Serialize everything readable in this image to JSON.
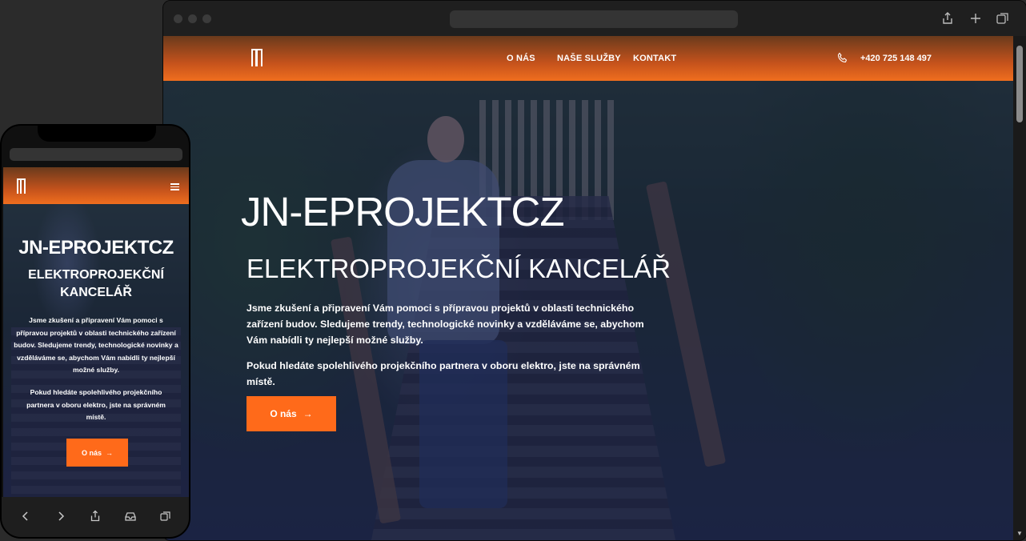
{
  "site": {
    "nav": [
      "O NÁS",
      "NAŠE SLUŽBY",
      "KONTAKT"
    ],
    "phone": "+420 725 148 497"
  },
  "hero": {
    "title": "JN-EPROJEKTCZ",
    "subtitle": "ELEKTROPROJEKČNÍ KANCELÁŘ",
    "paragraph1": "Jsme zkušení a připravení Vám pomoci s přípravou projektů v oblasti technického zařízení budov. Sledujeme trendy, technologické novinky a vzděláváme se, abychom Vám nabídli ty nejlepší možné služby.",
    "paragraph2": "Pokud hledáte spolehlivého projekčního partnera v oboru elektro, jste na správném místě.",
    "cta_label": "O nás",
    "cta_arrow": "→"
  },
  "colors": {
    "accent": "#ff6a1a",
    "overlay": "#161a42",
    "header_top": "#6a3a1c",
    "header_bottom": "#f06e1e"
  },
  "icons": {
    "chrome": [
      "share-icon",
      "new-tab-plus-icon",
      "tabs-overview-icon"
    ],
    "phone_toolbar": [
      "back-chevron-icon",
      "forward-chevron-icon",
      "share-icon",
      "inbox-icon",
      "tabs-icon"
    ]
  }
}
